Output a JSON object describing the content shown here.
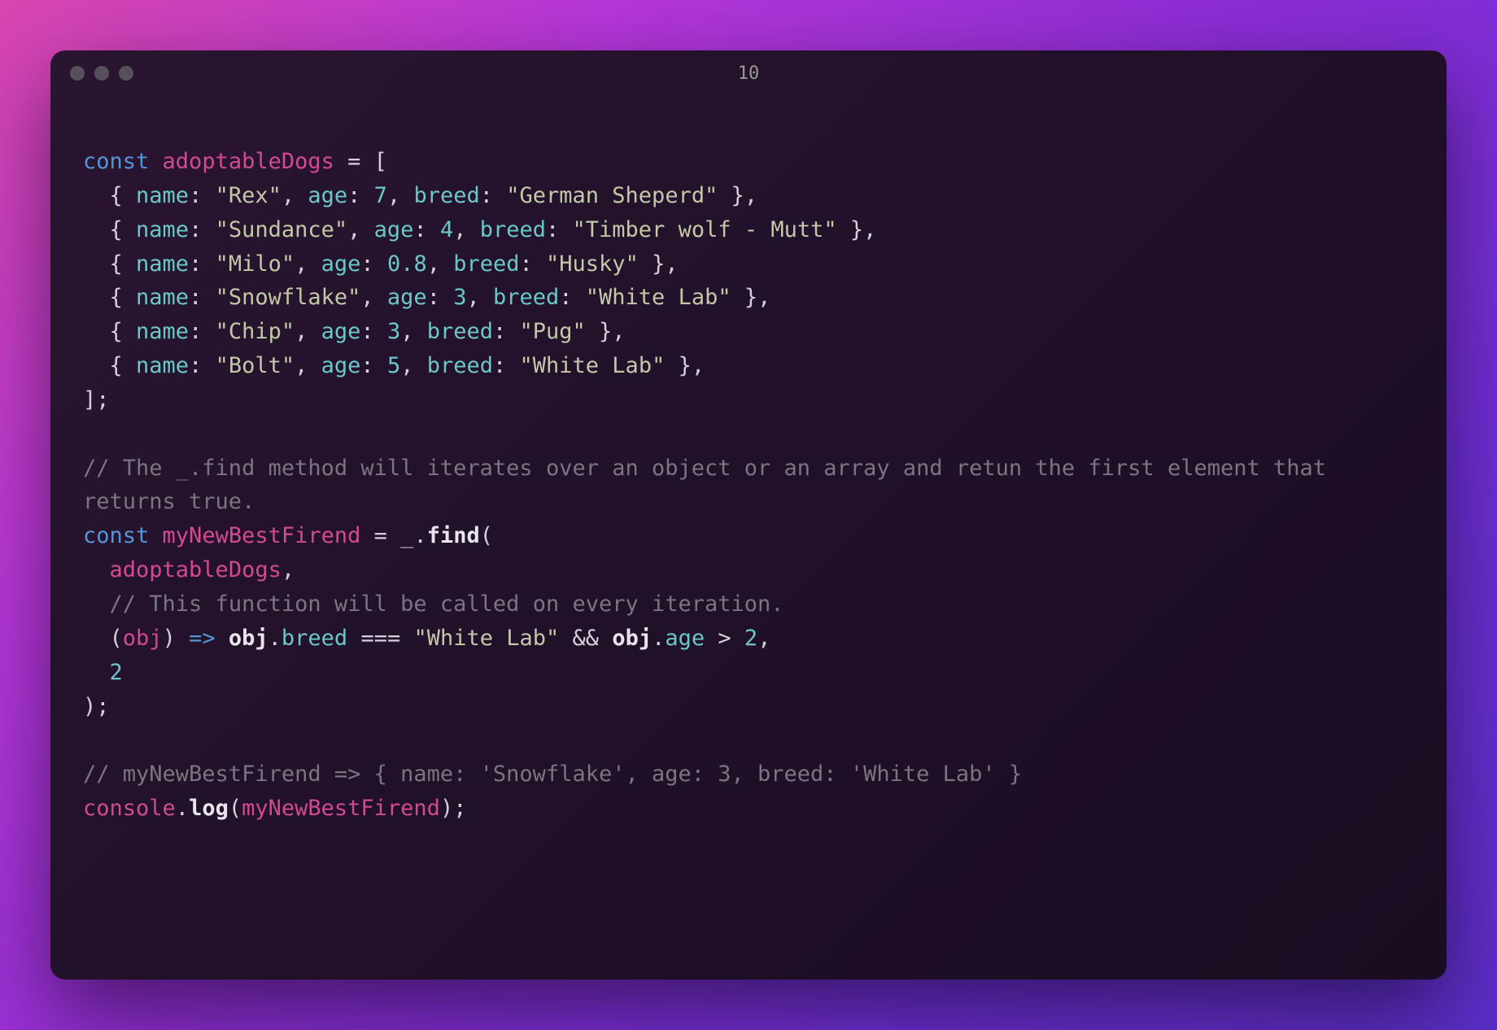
{
  "window": {
    "title": "10"
  },
  "code": {
    "line1": {
      "keyword": "const",
      "name": "adoptableDogs",
      "equals": " = ",
      "open": "["
    },
    "dogs": [
      {
        "name": "\"Rex\"",
        "age": "7",
        "breed": "\"German Sheperd\""
      },
      {
        "name": "\"Sundance\"",
        "age": "4",
        "breed": "\"Timber wolf - Mutt\""
      },
      {
        "name": "\"Milo\"",
        "age": "0.8",
        "breed": "\"Husky\""
      },
      {
        "name": "\"Snowflake\"",
        "age": "3",
        "breed": "\"White Lab\""
      },
      {
        "name": "\"Chip\"",
        "age": "3",
        "breed": "\"Pug\""
      },
      {
        "name": "\"Bolt\"",
        "age": "5",
        "breed": "\"White Lab\""
      }
    ],
    "close_array": "];",
    "comment1": "// The _.find method will iterates over an object or an array and retun the first element that returns true.",
    "line_find": {
      "keyword": "const",
      "name": "myNewBestFirend",
      "equals": " = ",
      "underscore": "_",
      "dot": ".",
      "func": "find",
      "open": "("
    },
    "arg1": "adoptableDogs",
    "comment2": "// This function will be called on every iteration.",
    "predicate": {
      "open": "(",
      "param": "obj",
      "close_paren": ")",
      "arrow": " => ",
      "obj1": "obj",
      "dot1": ".",
      "prop1": "breed",
      "eq": " === ",
      "str": "\"White Lab\"",
      "and": " && ",
      "obj2": "obj",
      "dot2": ".",
      "prop2": "age",
      "gt": " > ",
      "num": "2",
      "comma": ","
    },
    "arg3": "2",
    "close_call": ");",
    "comment3": "// myNewBestFirend => { name: 'Snowflake', age: 3, breed: 'White Lab' }",
    "log": {
      "console": "console",
      "dot": ".",
      "func": "log",
      "open": "(",
      "arg": "myNewBestFirend",
      "close": ");"
    },
    "labels": {
      "name": "name",
      "age": "age",
      "breed": "breed"
    }
  }
}
